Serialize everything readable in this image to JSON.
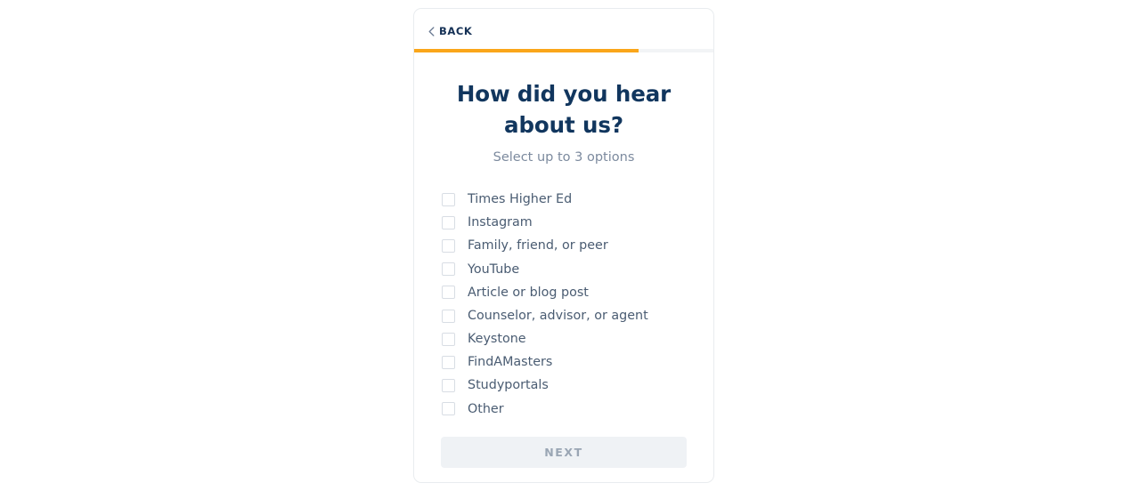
{
  "card": {
    "back": {
      "label": "BACK",
      "icon": "chevron-left-icon"
    },
    "progress": {
      "percent": 75,
      "fill_color": "#faa61a",
      "track_color": "#f2f4f6"
    },
    "title": "How did you hear about us?",
    "subtitle": "Select up to 3 options",
    "options": [
      {
        "label": "Times Higher Ed",
        "checked": false
      },
      {
        "label": "Instagram",
        "checked": false
      },
      {
        "label": "Family, friend, or peer",
        "checked": false
      },
      {
        "label": "YouTube",
        "checked": false
      },
      {
        "label": "Article or blog post",
        "checked": false
      },
      {
        "label": "Counselor, advisor, or agent",
        "checked": false
      },
      {
        "label": "Keystone",
        "checked": false
      },
      {
        "label": "FindAMasters",
        "checked": false
      },
      {
        "label": "Studyportals",
        "checked": false
      },
      {
        "label": "Other",
        "checked": false
      }
    ],
    "next_button": {
      "label": "NEXT",
      "disabled": true
    }
  },
  "colors": {
    "title": "#11365e",
    "subtitle": "#7c8a9e",
    "option_text": "#4a5c72",
    "accent_orange": "#faa61a",
    "back_text": "#143055",
    "next_bg": "#eff2f5",
    "next_text": "#9aa6b4",
    "card_border": "#e9ecef",
    "checkbox_border": "#d8dde4"
  }
}
